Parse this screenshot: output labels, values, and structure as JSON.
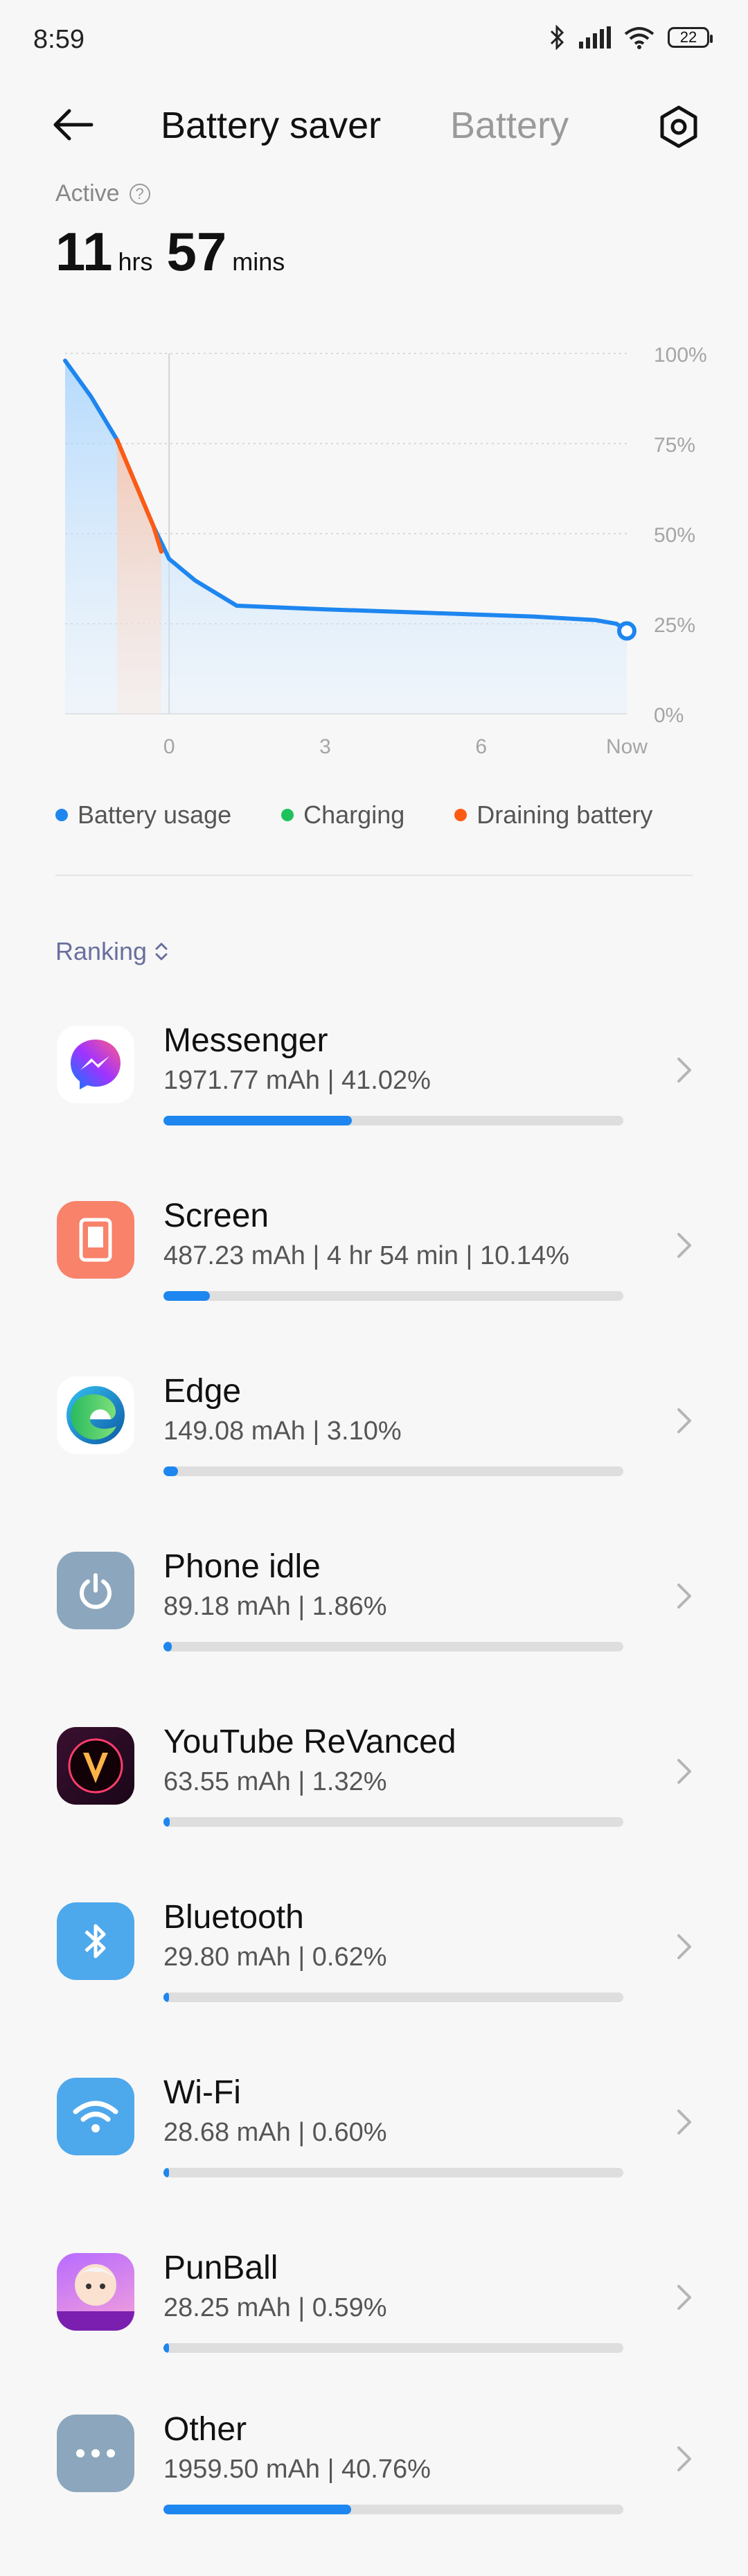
{
  "status_bar": {
    "time": "8:59",
    "battery_level": "22"
  },
  "header": {
    "title_active": "Battery saver",
    "title_inactive": "Battery"
  },
  "active": {
    "label": "Active",
    "help": "?",
    "hours": "11",
    "hours_unit": "hrs",
    "minutes": "57",
    "minutes_unit": "mins"
  },
  "chart_data": {
    "type": "line",
    "y_ticks": [
      "100%",
      "75%",
      "50%",
      "25%",
      "0%"
    ],
    "x_ticks": [
      "0",
      "3",
      "6",
      "Now"
    ],
    "series": [
      {
        "name": "Battery usage",
        "x": [
          -2.0,
          -1.5,
          -1.0,
          -0.3,
          0.0,
          0.5,
          1.3,
          3.0,
          5.0,
          7.0,
          8.2,
          8.6,
          8.8
        ],
        "y": [
          98,
          88,
          76,
          52,
          43,
          37,
          30,
          29,
          28,
          27,
          26,
          25,
          23
        ]
      },
      {
        "name": "Draining battery",
        "x": [
          -1.0,
          -0.3,
          -0.15
        ],
        "y": [
          76,
          52,
          45
        ]
      }
    ],
    "ylim": [
      0,
      100
    ],
    "xlim": [
      -2.0,
      8.8
    ],
    "colors": {
      "usage": "#1e86ef",
      "charging": "#1ec25a",
      "draining": "#ff5a12"
    }
  },
  "legend": {
    "usage": "Battery usage",
    "charging": "Charging",
    "draining": "Draining battery"
  },
  "ranking": {
    "label": "Ranking"
  },
  "apps": [
    {
      "name": "Messenger",
      "detail": "1971.77 mAh | 41.02%",
      "share": 0.4102,
      "icon": "messenger-icon"
    },
    {
      "name": "Screen",
      "detail": "487.23 mAh | 4 hr 54 min  | 10.14%",
      "share": 0.1014,
      "icon": "screen-icon"
    },
    {
      "name": "Edge",
      "detail": "149.08 mAh | 3.10%",
      "share": 0.031,
      "icon": "edge-icon"
    },
    {
      "name": "Phone idle",
      "detail": "89.18 mAh | 1.86%",
      "share": 0.0186,
      "icon": "power-icon"
    },
    {
      "name": "YouTube ReVanced",
      "detail": "63.55 mAh | 1.32%",
      "share": 0.0132,
      "icon": "youtube-revanced-icon"
    },
    {
      "name": "Bluetooth",
      "detail": "29.80 mAh | 0.62%",
      "share": 0.0062,
      "icon": "bluetooth-icon"
    },
    {
      "name": "Wi-Fi",
      "detail": "28.68 mAh | 0.60%",
      "share": 0.006,
      "icon": "wifi-icon"
    },
    {
      "name": "PunBall",
      "detail": "28.25 mAh | 0.59%",
      "share": 0.0059,
      "icon": "punball-icon"
    },
    {
      "name": "Other",
      "detail": "1959.50 mAh | 40.76%",
      "share": 0.4076,
      "icon": "more-icon"
    }
  ]
}
